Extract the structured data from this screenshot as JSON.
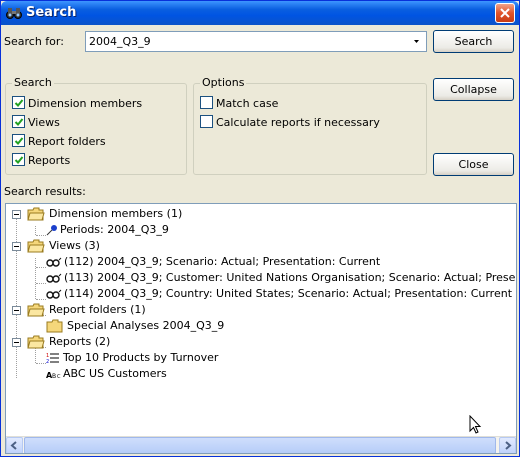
{
  "window": {
    "title": "Search"
  },
  "search": {
    "label": "Search for:",
    "value": "2004_Q3_9"
  },
  "buttons": {
    "search": "Search",
    "collapse": "Collapse",
    "close": "Close"
  },
  "search_group": {
    "title": "Search",
    "items": [
      {
        "label": "Dimension members",
        "checked": true
      },
      {
        "label": "Views",
        "checked": true
      },
      {
        "label": "Report folders",
        "checked": true
      },
      {
        "label": "Reports",
        "checked": true
      }
    ]
  },
  "options_group": {
    "title": "Options",
    "items": [
      {
        "label": "Match case",
        "checked": false
      },
      {
        "label": "Calculate reports if necessary",
        "checked": false
      }
    ]
  },
  "results": {
    "label": "Search results:",
    "tree": [
      {
        "label": "Dimension members (1)",
        "icon": "folder-icon",
        "children": [
          {
            "label": "Periods: 2004_Q3_9",
            "icon": "pin-icon"
          }
        ]
      },
      {
        "label": "Views (3)",
        "icon": "folder-icon",
        "children": [
          {
            "label": "(112) 2004_Q3_9; Scenario: Actual; Presentation: Current",
            "icon": "view-icon"
          },
          {
            "label": "(113) 2004_Q3_9; Customer: United Nations Organisation; Scenario: Actual; Presentation: Current",
            "icon": "view-icon"
          },
          {
            "label": "(114) 2004_Q3_9; Country: United States; Scenario: Actual; Presentation: Current",
            "icon": "view-icon"
          }
        ]
      },
      {
        "label": "Report folders (1)",
        "icon": "folder-icon",
        "children": [
          {
            "label": "Special Analyses 2004_Q3_9",
            "icon": "folder-icon"
          }
        ]
      },
      {
        "label": "Reports (2)",
        "icon": "folder-icon",
        "children": [
          {
            "label": "Top 10 Products by Turnover",
            "icon": "list-report-icon"
          },
          {
            "label": "ABC US Customers",
            "icon": "abc-report-icon"
          }
        ]
      }
    ]
  }
}
